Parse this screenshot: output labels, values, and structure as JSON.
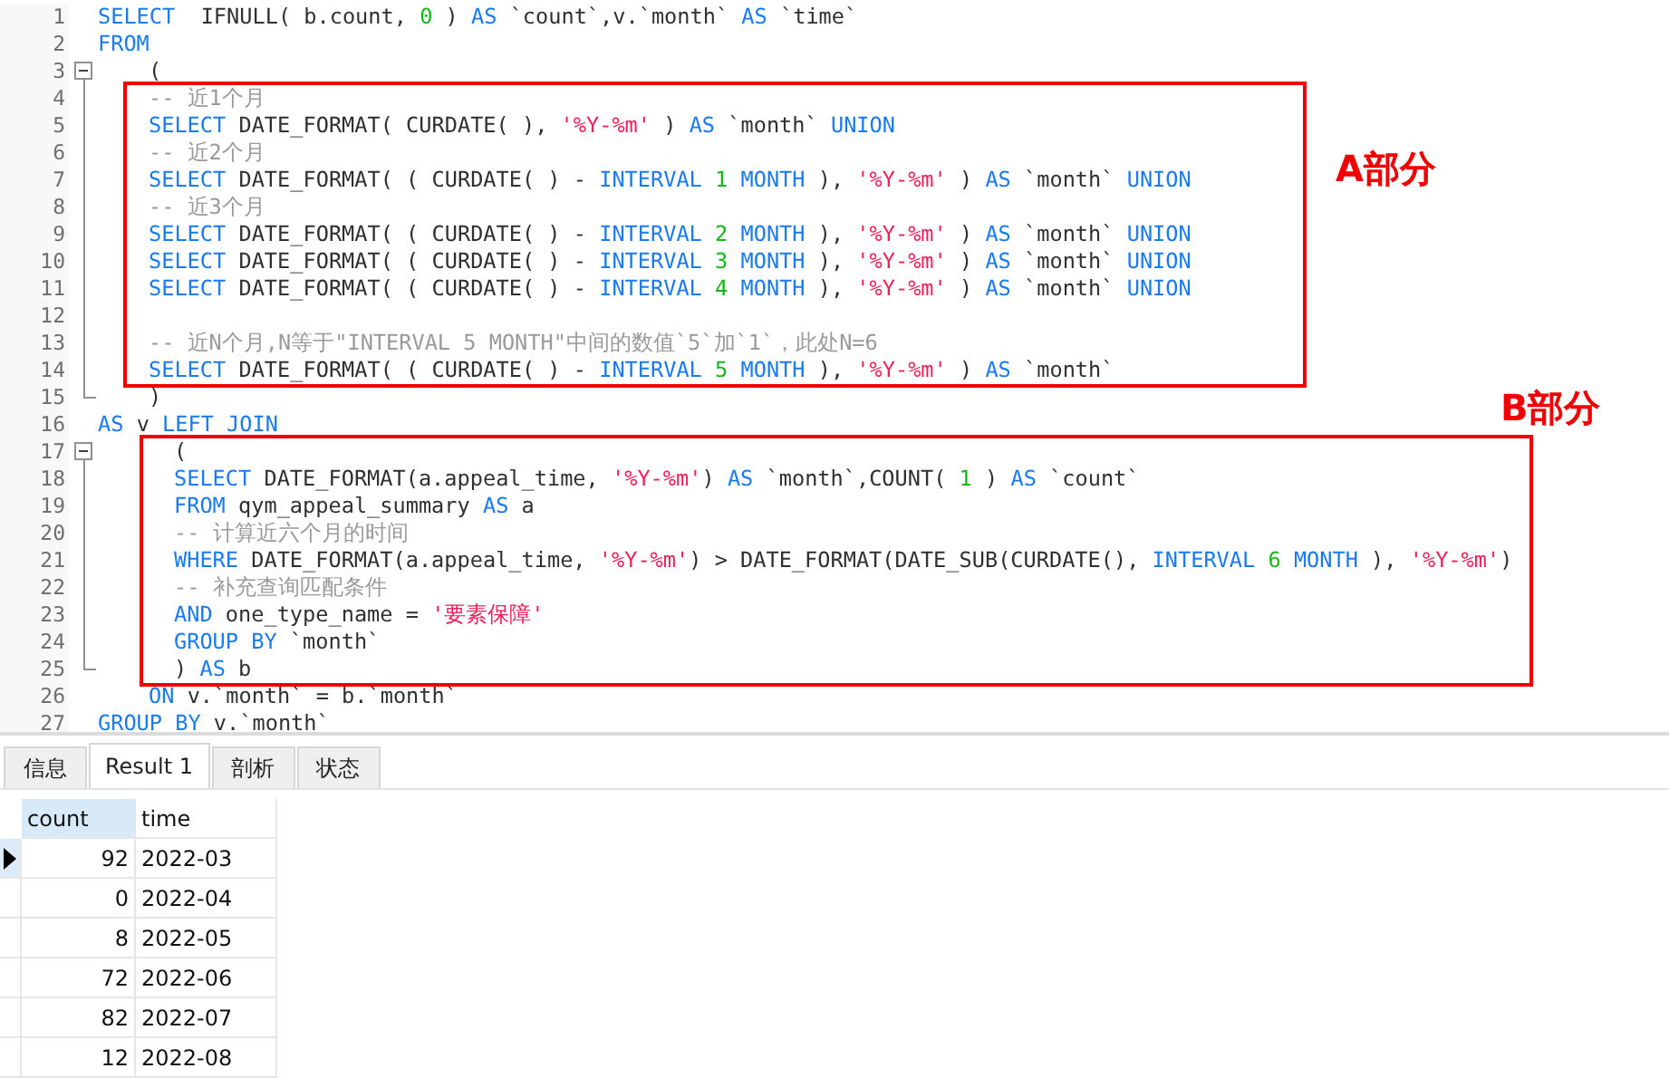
{
  "editor": {
    "lines": [
      {
        "number": "1",
        "tokens": [
          {
            "kind": "kw",
            "text": "SELECT"
          },
          {
            "kind": "txt",
            "text": "  IFNULL( b.count, "
          },
          {
            "kind": "num",
            "text": "0"
          },
          {
            "kind": "txt",
            "text": " ) "
          },
          {
            "kind": "kw",
            "text": "AS"
          },
          {
            "kind": "txt",
            "text": " `count`,v.`month` "
          },
          {
            "kind": "kw",
            "text": "AS"
          },
          {
            "kind": "txt",
            "text": " `time`"
          }
        ]
      },
      {
        "number": "2",
        "tokens": [
          {
            "kind": "kw",
            "text": "FROM"
          }
        ]
      },
      {
        "number": "3",
        "fold_start": true,
        "indented": true,
        "tokens": [
          {
            "kind": "txt",
            "text": "("
          }
        ]
      },
      {
        "number": "4",
        "in_fold": true,
        "boxed": true,
        "indented": true,
        "tokens": [
          {
            "kind": "cmt",
            "text": "-- 近1个月"
          }
        ]
      },
      {
        "number": "5",
        "in_fold": true,
        "boxed": true,
        "indented": true,
        "tokens": [
          {
            "kind": "kw",
            "text": "SELECT"
          },
          {
            "kind": "txt",
            "text": " DATE_FORMAT( CURDATE( ), "
          },
          {
            "kind": "str",
            "text": "'%Y-%m'"
          },
          {
            "kind": "txt",
            "text": " ) "
          },
          {
            "kind": "kw",
            "text": "AS"
          },
          {
            "kind": "txt",
            "text": " `month` "
          },
          {
            "kind": "kw",
            "text": "UNION"
          }
        ]
      },
      {
        "number": "6",
        "in_fold": true,
        "boxed": true,
        "indented": true,
        "tokens": [
          {
            "kind": "cmt",
            "text": "-- 近2个月"
          }
        ]
      },
      {
        "number": "7",
        "in_fold": true,
        "boxed": true,
        "indented": true,
        "tokens": [
          {
            "kind": "kw",
            "text": "SELECT"
          },
          {
            "kind": "txt",
            "text": " DATE_FORMAT( ( CURDATE( ) - "
          },
          {
            "kind": "kw",
            "text": "INTERVAL"
          },
          {
            "kind": "num",
            "text": " 1 "
          },
          {
            "kind": "kw",
            "text": "MONTH"
          },
          {
            "kind": "txt",
            "text": " ), "
          },
          {
            "kind": "str",
            "text": "'%Y-%m'"
          },
          {
            "kind": "txt",
            "text": " ) "
          },
          {
            "kind": "kw",
            "text": "AS"
          },
          {
            "kind": "txt",
            "text": " `month` "
          },
          {
            "kind": "kw",
            "text": "UNION"
          }
        ]
      },
      {
        "number": "8",
        "in_fold": true,
        "boxed": true,
        "indented": true,
        "tokens": [
          {
            "kind": "cmt",
            "text": "-- 近3个月"
          }
        ]
      },
      {
        "number": "9",
        "in_fold": true,
        "boxed": true,
        "indented": true,
        "tokens": [
          {
            "kind": "kw",
            "text": "SELECT"
          },
          {
            "kind": "txt",
            "text": " DATE_FORMAT( ( CURDATE( ) - "
          },
          {
            "kind": "kw",
            "text": "INTERVAL"
          },
          {
            "kind": "num",
            "text": " 2 "
          },
          {
            "kind": "kw",
            "text": "MONTH"
          },
          {
            "kind": "txt",
            "text": " ), "
          },
          {
            "kind": "str",
            "text": "'%Y-%m'"
          },
          {
            "kind": "txt",
            "text": " ) "
          },
          {
            "kind": "kw",
            "text": "AS"
          },
          {
            "kind": "txt",
            "text": " `month` "
          },
          {
            "kind": "kw",
            "text": "UNION"
          }
        ]
      },
      {
        "number": "10",
        "in_fold": true,
        "boxed": true,
        "indented": true,
        "tokens": [
          {
            "kind": "kw",
            "text": "SELECT"
          },
          {
            "kind": "txt",
            "text": " DATE_FORMAT( ( CURDATE( ) - "
          },
          {
            "kind": "kw",
            "text": "INTERVAL"
          },
          {
            "kind": "num",
            "text": " 3 "
          },
          {
            "kind": "kw",
            "text": "MONTH"
          },
          {
            "kind": "txt",
            "text": " ), "
          },
          {
            "kind": "str",
            "text": "'%Y-%m'"
          },
          {
            "kind": "txt",
            "text": " ) "
          },
          {
            "kind": "kw",
            "text": "AS"
          },
          {
            "kind": "txt",
            "text": " `month` "
          },
          {
            "kind": "kw",
            "text": "UNION"
          }
        ]
      },
      {
        "number": "11",
        "in_fold": true,
        "boxed": true,
        "indented": true,
        "tokens": [
          {
            "kind": "kw",
            "text": "SELECT"
          },
          {
            "kind": "txt",
            "text": " DATE_FORMAT( ( CURDATE( ) - "
          },
          {
            "kind": "kw",
            "text": "INTERVAL"
          },
          {
            "kind": "num",
            "text": " 4 "
          },
          {
            "kind": "kw",
            "text": "MONTH"
          },
          {
            "kind": "txt",
            "text": " ), "
          },
          {
            "kind": "str",
            "text": "'%Y-%m'"
          },
          {
            "kind": "txt",
            "text": " ) "
          },
          {
            "kind": "kw",
            "text": "AS"
          },
          {
            "kind": "txt",
            "text": " `month` "
          },
          {
            "kind": "kw",
            "text": "UNION"
          }
        ]
      },
      {
        "number": "12",
        "in_fold": true,
        "boxed": true
      },
      {
        "number": "13",
        "in_fold": true,
        "boxed": true,
        "indented": true,
        "tokens": [
          {
            "kind": "cmt",
            "text": "-- 近N个月,N等于\"INTERVAL 5 MONTH\"中间的数值`5`加`1`，此处N=6"
          }
        ]
      },
      {
        "number": "14",
        "in_fold": true,
        "boxed": true,
        "indented": true,
        "tokens": [
          {
            "kind": "kw",
            "text": "SELECT"
          },
          {
            "kind": "txt",
            "text": " DATE_FORMAT( ( CURDATE( ) - "
          },
          {
            "kind": "kw",
            "text": "INTERVAL"
          },
          {
            "kind": "num",
            "text": " 5 "
          },
          {
            "kind": "kw",
            "text": "MONTH"
          },
          {
            "kind": "txt",
            "text": " ), "
          },
          {
            "kind": "str",
            "text": "'%Y-%m'"
          },
          {
            "kind": "txt",
            "text": " ) "
          },
          {
            "kind": "kw",
            "text": "AS"
          },
          {
            "kind": "txt",
            "text": " `month`"
          }
        ]
      },
      {
        "number": "15",
        "fold_end": true,
        "indented": true,
        "tokens": [
          {
            "kind": "txt",
            "text": ")"
          }
        ]
      },
      {
        "number": "16",
        "tokens": [
          {
            "kind": "kw",
            "text": "AS"
          },
          {
            "kind": "txt",
            "text": " v "
          },
          {
            "kind": "kw",
            "text": "LEFT JOIN"
          }
        ]
      },
      {
        "number": "17",
        "fold_start": true,
        "boxed": true,
        "deep": true,
        "tokens": [
          {
            "kind": "txt",
            "text": "("
          }
        ]
      },
      {
        "number": "18",
        "in_fold": true,
        "boxed": true,
        "deep": true,
        "tokens": [
          {
            "kind": "kw",
            "text": "SELECT"
          },
          {
            "kind": "txt",
            "text": " DATE_FORMAT(a.appeal_time, "
          },
          {
            "kind": "str",
            "text": "'%Y-%m'"
          },
          {
            "kind": "txt",
            "text": ") "
          },
          {
            "kind": "kw",
            "text": "AS"
          },
          {
            "kind": "txt",
            "text": " `month`,COUNT( "
          },
          {
            "kind": "num",
            "text": "1"
          },
          {
            "kind": "txt",
            "text": " ) "
          },
          {
            "kind": "kw",
            "text": "AS"
          },
          {
            "kind": "txt",
            "text": " `count`"
          }
        ]
      },
      {
        "number": "19",
        "in_fold": true,
        "boxed": true,
        "deep": true,
        "tokens": [
          {
            "kind": "kw",
            "text": "FROM"
          },
          {
            "kind": "txt",
            "text": " qym_appeal_summary "
          },
          {
            "kind": "kw",
            "text": "AS"
          },
          {
            "kind": "txt",
            "text": " a"
          }
        ]
      },
      {
        "number": "20",
        "in_fold": true,
        "boxed": true,
        "deep": true,
        "tokens": [
          {
            "kind": "cmt",
            "text": "-- 计算近六个月的时间"
          }
        ]
      },
      {
        "number": "21",
        "in_fold": true,
        "boxed": true,
        "deep": true,
        "tokens": [
          {
            "kind": "kw",
            "text": "WHERE"
          },
          {
            "kind": "txt",
            "text": " DATE_FORMAT(a.appeal_time, "
          },
          {
            "kind": "str",
            "text": "'%Y-%m'"
          },
          {
            "kind": "txt",
            "text": ") > DATE_FORMAT(DATE_SUB(CURDATE(), "
          },
          {
            "kind": "kw",
            "text": "INTERVAL"
          },
          {
            "kind": "num",
            "text": " 6 "
          },
          {
            "kind": "kw",
            "text": "MONTH"
          },
          {
            "kind": "txt",
            "text": " ), "
          },
          {
            "kind": "str",
            "text": "'%Y-%m'"
          },
          {
            "kind": "txt",
            "text": ")"
          }
        ]
      },
      {
        "number": "22",
        "in_fold": true,
        "boxed": true,
        "deep": true,
        "tokens": [
          {
            "kind": "cmt",
            "text": "-- 补充查询匹配条件"
          }
        ]
      },
      {
        "number": "23",
        "in_fold": true,
        "boxed": true,
        "deep": true,
        "tokens": [
          {
            "kind": "kw",
            "text": "AND"
          },
          {
            "kind": "txt",
            "text": " one_type_name = "
          },
          {
            "kind": "str",
            "text": "'要素保障'"
          }
        ]
      },
      {
        "number": "24",
        "in_fold": true,
        "boxed": true,
        "deep": true,
        "tokens": [
          {
            "kind": "kw",
            "text": "GROUP BY"
          },
          {
            "kind": "txt",
            "text": " `month`"
          }
        ]
      },
      {
        "number": "25",
        "fold_end": true,
        "boxed": true,
        "deep": true,
        "tokens": [
          {
            "kind": "txt",
            "text": ") "
          },
          {
            "kind": "kw",
            "text": "AS"
          },
          {
            "kind": "txt",
            "text": " b"
          }
        ]
      },
      {
        "number": "26",
        "indented": true,
        "tokens": [
          {
            "kind": "kw",
            "text": "ON"
          },
          {
            "kind": "txt",
            "text": " v.`month` = b.`month`"
          }
        ]
      },
      {
        "number": "27",
        "tokens": [
          {
            "kind": "kw",
            "text": "GROUP BY"
          },
          {
            "kind": "txt",
            "text": " v.`month`"
          }
        ]
      }
    ],
    "annotations": [
      {
        "label": "A部分"
      },
      {
        "label": "B部分"
      }
    ]
  },
  "result_tabs": [
    {
      "label": "信息",
      "selected": false
    },
    {
      "label": "Result 1",
      "selected": true
    },
    {
      "label": "剖析",
      "selected": false
    },
    {
      "label": "状态",
      "selected": false
    }
  ],
  "result_grid": {
    "columns": [
      "count",
      "time"
    ],
    "rows": [
      {
        "cells": [
          "92",
          "2022-03"
        ],
        "selected": true
      },
      {
        "cells": [
          "0",
          "2022-04"
        ],
        "selected": false
      },
      {
        "cells": [
          "8",
          "2022-05"
        ],
        "selected": false
      },
      {
        "cells": [
          "72",
          "2022-06"
        ],
        "selected": false
      },
      {
        "cells": [
          "82",
          "2022-07"
        ],
        "selected": false
      },
      {
        "cells": [
          "12",
          "2022-08"
        ],
        "selected": false
      }
    ]
  }
}
